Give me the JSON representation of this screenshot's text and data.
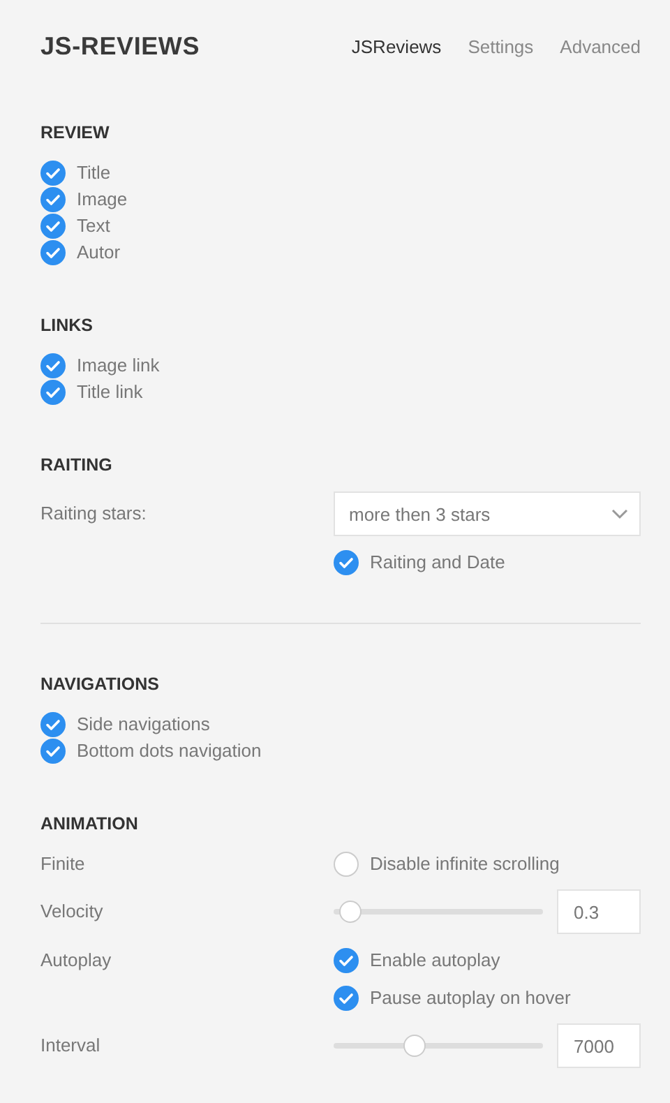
{
  "header": {
    "title": "JS-REVIEWS",
    "tabs": [
      {
        "label": "JSReviews",
        "selected": true
      },
      {
        "label": "Settings",
        "selected": false
      },
      {
        "label": "Advanced",
        "selected": false
      }
    ]
  },
  "sections": [
    {
      "heading": "REVIEW",
      "kind": "checklist",
      "items": [
        {
          "label": "Title",
          "checked": true
        },
        {
          "label": "Image",
          "checked": true
        },
        {
          "label": "Text",
          "checked": true
        },
        {
          "label": "Autor",
          "checked": true
        }
      ]
    },
    {
      "heading": "LINKS",
      "kind": "checklist",
      "items": [
        {
          "label": "Image link",
          "checked": true
        },
        {
          "label": "Title link",
          "checked": true
        }
      ]
    },
    {
      "heading": "RAITING",
      "kind": "form",
      "divider_after": true,
      "rows": [
        {
          "label": "Raiting stars:",
          "controls": [
            {
              "kind": "select",
              "value": "more then 3 stars"
            }
          ]
        },
        {
          "controls": [
            {
              "kind": "checkbox",
              "label": "Raiting and Date",
              "checked": true
            }
          ]
        }
      ]
    },
    {
      "heading": "NAVIGATIONS",
      "kind": "checklist",
      "items": [
        {
          "label": "Side navigations",
          "checked": true
        },
        {
          "label": "Bottom dots navigation",
          "checked": true
        }
      ]
    },
    {
      "heading": "ANIMATION",
      "kind": "form",
      "rows": [
        {
          "label": "Finite",
          "controls": [
            {
              "kind": "radio",
              "label": "Disable infinite scrolling",
              "checked": false
            }
          ]
        },
        {
          "label": "Velocity",
          "controls": [
            {
              "kind": "slider",
              "level": 0.08,
              "value": "0.3"
            }
          ]
        },
        {
          "label": "Autoplay",
          "controls": [
            {
              "kind": "checkbox",
              "label": "Enable autoplay",
              "checked": true
            },
            {
              "kind": "checkbox",
              "label": "Pause autoplay on hover",
              "checked": true
            }
          ]
        },
        {
          "label": "Interval",
          "controls": [
            {
              "kind": "slider",
              "level": 0.39,
              "value": "7000"
            }
          ]
        }
      ]
    }
  ]
}
